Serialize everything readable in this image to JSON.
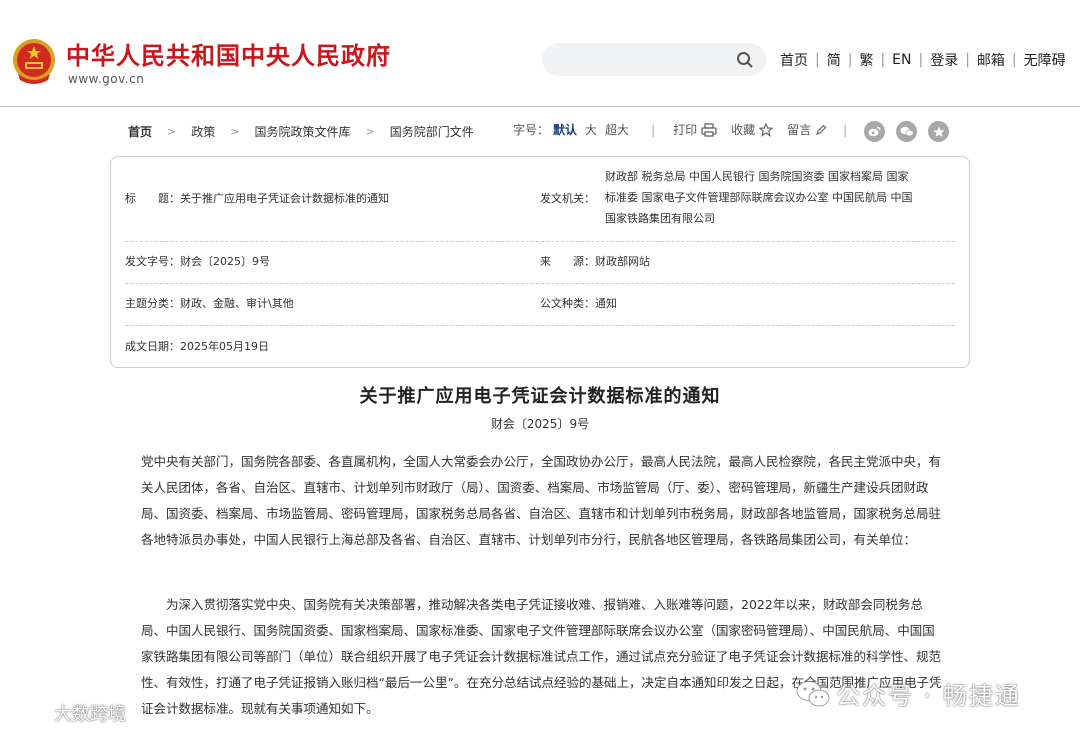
{
  "header": {
    "site_title": "中华人民共和国中央人民政府",
    "site_url": "www.gov.cn",
    "search_placeholder": "",
    "nav": [
      "首页",
      "简",
      "繁",
      "EN",
      "登录",
      "邮箱",
      "无障碍"
    ]
  },
  "breadcrumb": [
    "首页",
    "政策",
    "国务院政策文件库",
    "国务院部门文件"
  ],
  "tools": {
    "font_size_label": "字号：",
    "font_default": "默认",
    "font_large": "大",
    "font_xlarge": "超大",
    "print": "打印",
    "favorite": "收藏",
    "comment": "留言"
  },
  "info": {
    "title_label": "标　　题：",
    "title_value": "关于推广应用电子凭证会计数据标准的通知",
    "issuer_label": "发文机关：",
    "issuer_line1": "财政部  税务总局  中国人民银行  国务院国资委  国家档案局  国家",
    "issuer_line2": "标准委  国家电子文件管理部际联席会议办公室  中国民航局  中国",
    "issuer_line3": "国家铁路集团有限公司",
    "docno_label": "发文字号：",
    "docno_value": "财会〔2025〕9号",
    "source_label": "来　　源：",
    "source_value": "财政部网站",
    "topic_label": "主题分类：",
    "topic_value": "财政、金融、审计\\其他",
    "type_label": "公文种类：",
    "type_value": "通知",
    "date_label": "成文日期：",
    "date_value": "2025年05月19日"
  },
  "document": {
    "title": "关于推广应用电子凭证会计数据标准的通知",
    "number": "财会〔2025〕9号",
    "recipients": "党中央有关部门，国务院各部委、各直属机构，全国人大常委会办公厅，全国政协办公厅，最高人民法院，最高人民检察院，各民主党派中央，有关人民团体，各省、自治区、直辖市、计划单列市财政厅（局）、国资委、档案局、市场监管局（厅、委）、密码管理局，新疆生产建设兵团财政局、国资委、档案局、市场监管局、密码管理局，国家税务总局各省、自治区、直辖市和计划单列市税务局，财政部各地监管局，国家税务总局驻各地特派员办事处，中国人民银行上海总部及各省、自治区、直辖市、计划单列市分行，民航各地区管理局，各铁路局集团公司，有关单位：",
    "body": "为深入贯彻落实党中央、国务院有关决策部署，推动解决各类电子凭证接收难、报销难、入账难等问题，2022年以来，财政部会同税务总局、中国人民银行、国务院国资委、国家档案局、国家标准委、国家电子文件管理部际联席会议办公室（国家密码管理局）、中国民航局、中国国家铁路集团有限公司等部门（单位）联合组织开展了电子凭证会计数据标准试点工作，通过试点充分验证了电子凭证会计数据标准的科学性、规范性、有效性，打通了电子凭证报销入账归档“最后一公里”。在充分总结试点经验的基础上，决定自本通知印发之日起，在全国范围推广应用电子凭证会计数据标准。现就有关事项通知如下。"
  },
  "watermarks": {
    "left": "大数跨境",
    "right": "公众号 · 畅捷通"
  },
  "colors": {
    "brand_red": "#c8161d",
    "link_blue": "#1c3f82"
  }
}
